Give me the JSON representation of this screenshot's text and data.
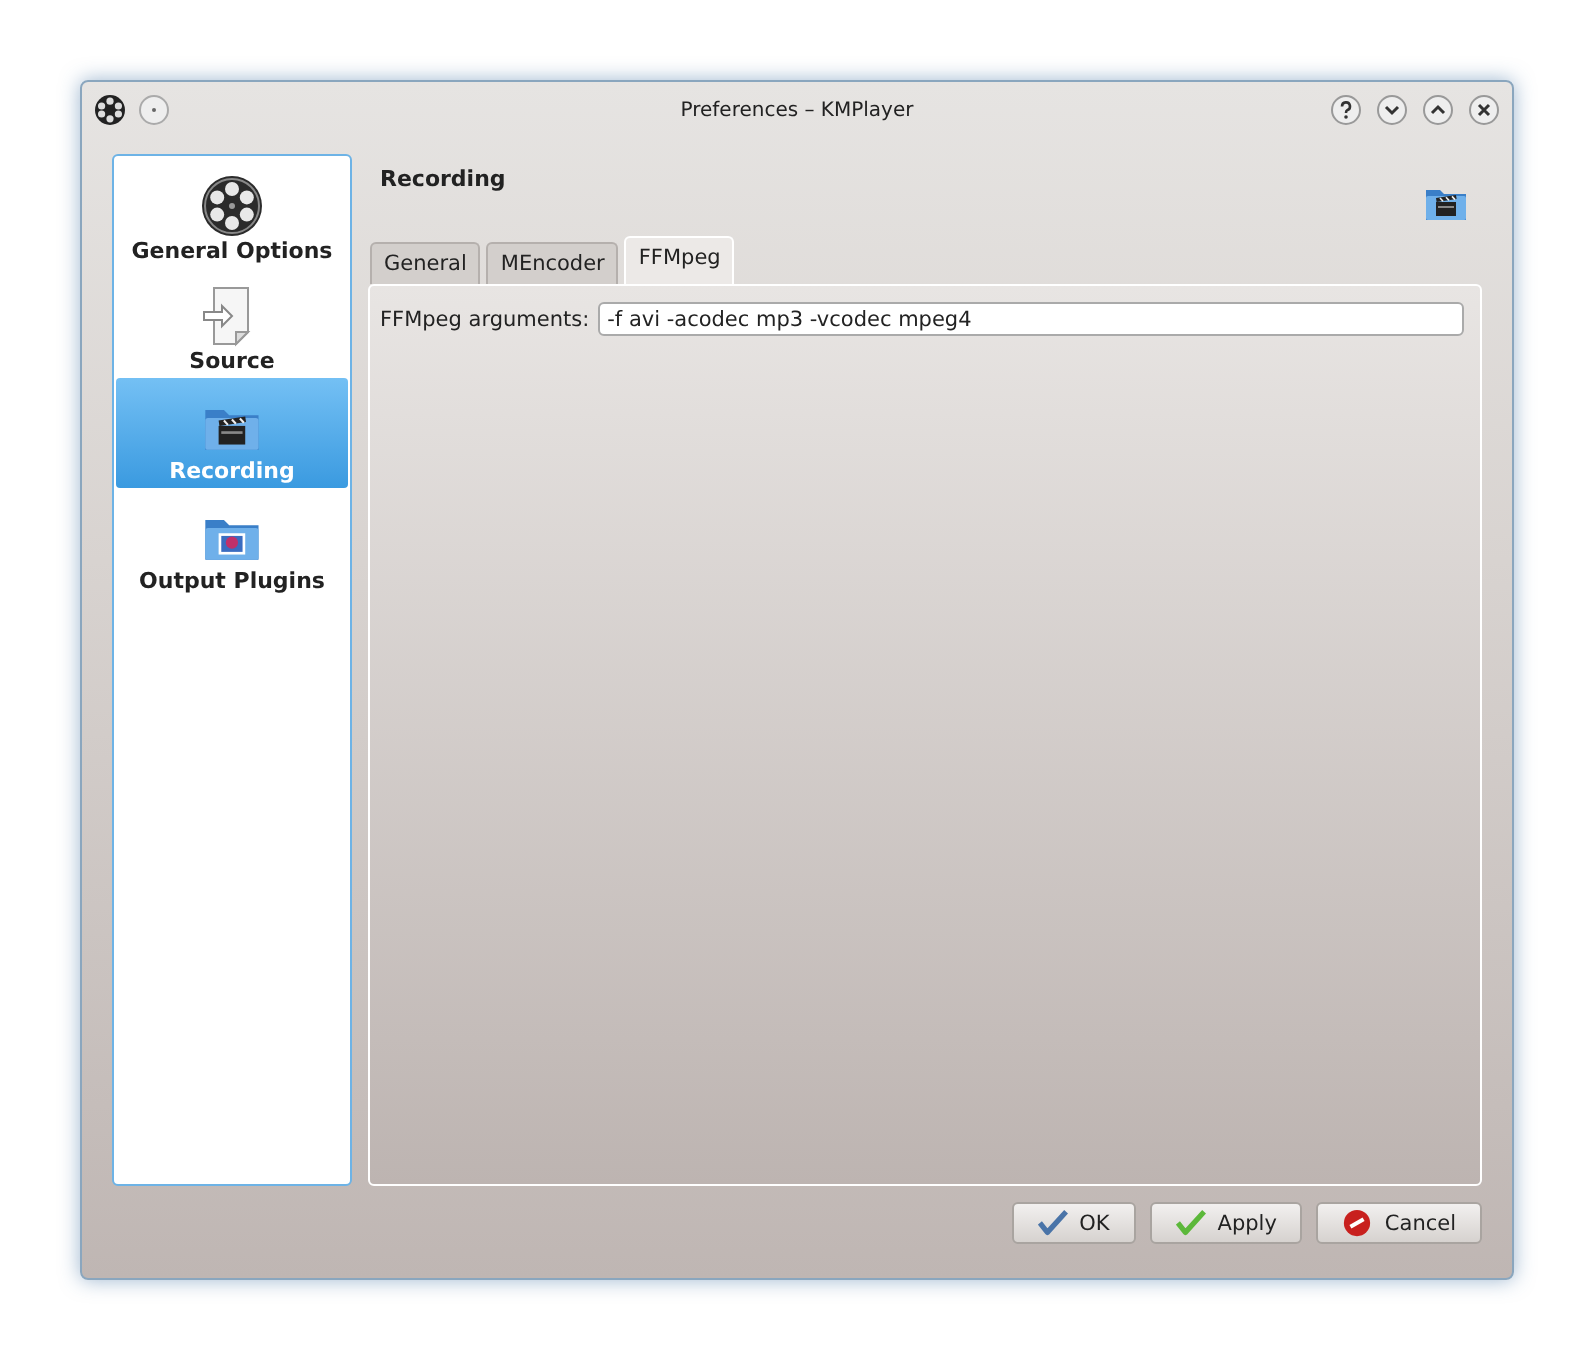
{
  "window": {
    "title": "Preferences – KMPlayer"
  },
  "sidebar": {
    "items": [
      {
        "label": "General Options",
        "kind": "reel",
        "selected": false
      },
      {
        "label": "Source",
        "kind": "document",
        "selected": false
      },
      {
        "label": "Recording",
        "kind": "clapper",
        "selected": true
      },
      {
        "label": "Output Plugins",
        "kind": "picture",
        "selected": false
      }
    ]
  },
  "page": {
    "title": "Recording"
  },
  "tabs": [
    {
      "label": "General",
      "selected": false
    },
    {
      "label": "MEncoder",
      "selected": false
    },
    {
      "label": "FFMpeg",
      "selected": true
    }
  ],
  "fields": [
    {
      "label": "FFMpeg arguments:",
      "value": "-f avi -acodec mp3 -vcodec mpeg4"
    }
  ],
  "buttons": [
    {
      "label": "OK",
      "kind": "ok"
    },
    {
      "label": "Apply",
      "kind": "apply"
    },
    {
      "label": "Cancel",
      "kind": "cancel"
    }
  ]
}
